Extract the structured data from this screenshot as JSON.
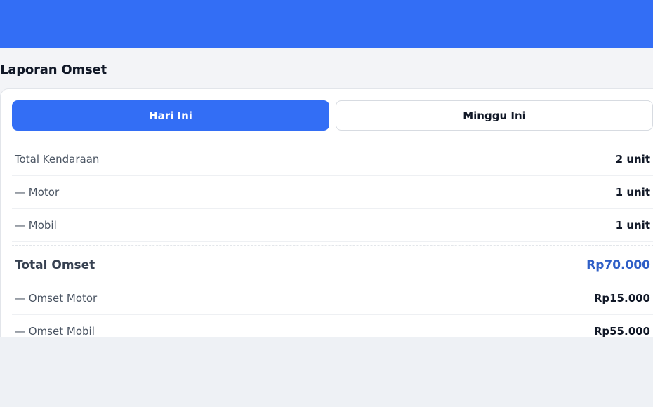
{
  "page": {
    "title": "Laporan Omset"
  },
  "tabs": [
    {
      "label": "Hari Ini",
      "active": true
    },
    {
      "label": "Minggu Ini",
      "active": false
    }
  ],
  "stats": {
    "total_kendaraan": {
      "label": "Total Kendaraan",
      "value": "2 unit"
    },
    "motor": {
      "label": "— Motor",
      "value": "1 unit"
    },
    "mobil": {
      "label": "— Mobil",
      "value": "1 unit"
    },
    "total_omset": {
      "label": "Total Omset",
      "value": "Rp70.000"
    },
    "omset_motor": {
      "label": "— Omset Motor",
      "value": "Rp15.000"
    },
    "omset_mobil": {
      "label": "— Omset Mobil",
      "value": "Rp55.000"
    }
  },
  "colors": {
    "primary": "#336ef5",
    "total_value": "#2f5fc7",
    "background": "#f3f4f7"
  }
}
